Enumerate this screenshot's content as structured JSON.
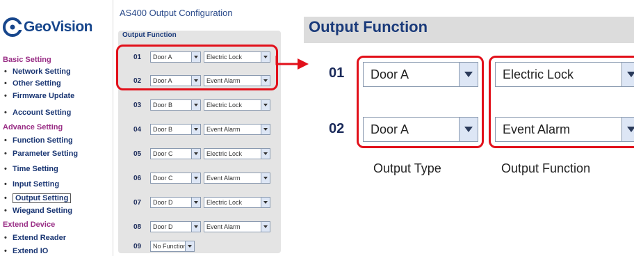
{
  "brand": {
    "name": "GeoVision"
  },
  "sidebar": {
    "sections": [
      {
        "title": "Basic Setting",
        "items": [
          {
            "label": "Network Setting"
          },
          {
            "label": "Other Setting"
          },
          {
            "label": "Firmware Update"
          },
          {
            "label": "Account Setting"
          }
        ]
      },
      {
        "title": "Advance Setting",
        "items": [
          {
            "label": "Function Setting"
          },
          {
            "label": "Parameter Setting"
          },
          {
            "label": "Time Setting"
          },
          {
            "label": "Input Setting"
          },
          {
            "label": "Output Setting",
            "active": true
          },
          {
            "label": "Wiegand Setting"
          }
        ]
      },
      {
        "title": "Extend Device",
        "items": [
          {
            "label": "Extend Reader"
          },
          {
            "label": "Extend IO"
          }
        ]
      }
    ],
    "bullet": "•"
  },
  "page": {
    "title": "AS400 Output Configuration",
    "panel_header": "Output Function"
  },
  "outputs": [
    {
      "num": "01",
      "type": "Door A",
      "function": "Electric Lock"
    },
    {
      "num": "02",
      "type": "Door A",
      "function": "Event Alarm"
    },
    {
      "num": "03",
      "type": "Door B",
      "function": "Electric Lock"
    },
    {
      "num": "04",
      "type": "Door B",
      "function": "Event Alarm"
    },
    {
      "num": "05",
      "type": "Door C",
      "function": "Electric Lock"
    },
    {
      "num": "06",
      "type": "Door C",
      "function": "Event Alarm"
    },
    {
      "num": "07",
      "type": "Door D",
      "function": "Electric Lock"
    },
    {
      "num": "08",
      "type": "Door D",
      "function": "Event Alarm"
    },
    {
      "num": "09",
      "type": "No Function",
      "function": ""
    }
  ],
  "zoom": {
    "header": "Output Function",
    "rows": [
      {
        "num": "01",
        "type": "Door A",
        "function": "Electric Lock"
      },
      {
        "num": "02",
        "type": "Door A",
        "function": "Event Alarm"
      }
    ],
    "caption_type": "Output Type",
    "caption_function": "Output Function"
  },
  "colors": {
    "annotation": "#e2101a",
    "section": "#9a2f86",
    "nav": "#1a3673",
    "brand": "#17468c"
  },
  "icons": [
    "geovision-logo-icon",
    "chevron-down-icon",
    "arrow-right-icon"
  ]
}
